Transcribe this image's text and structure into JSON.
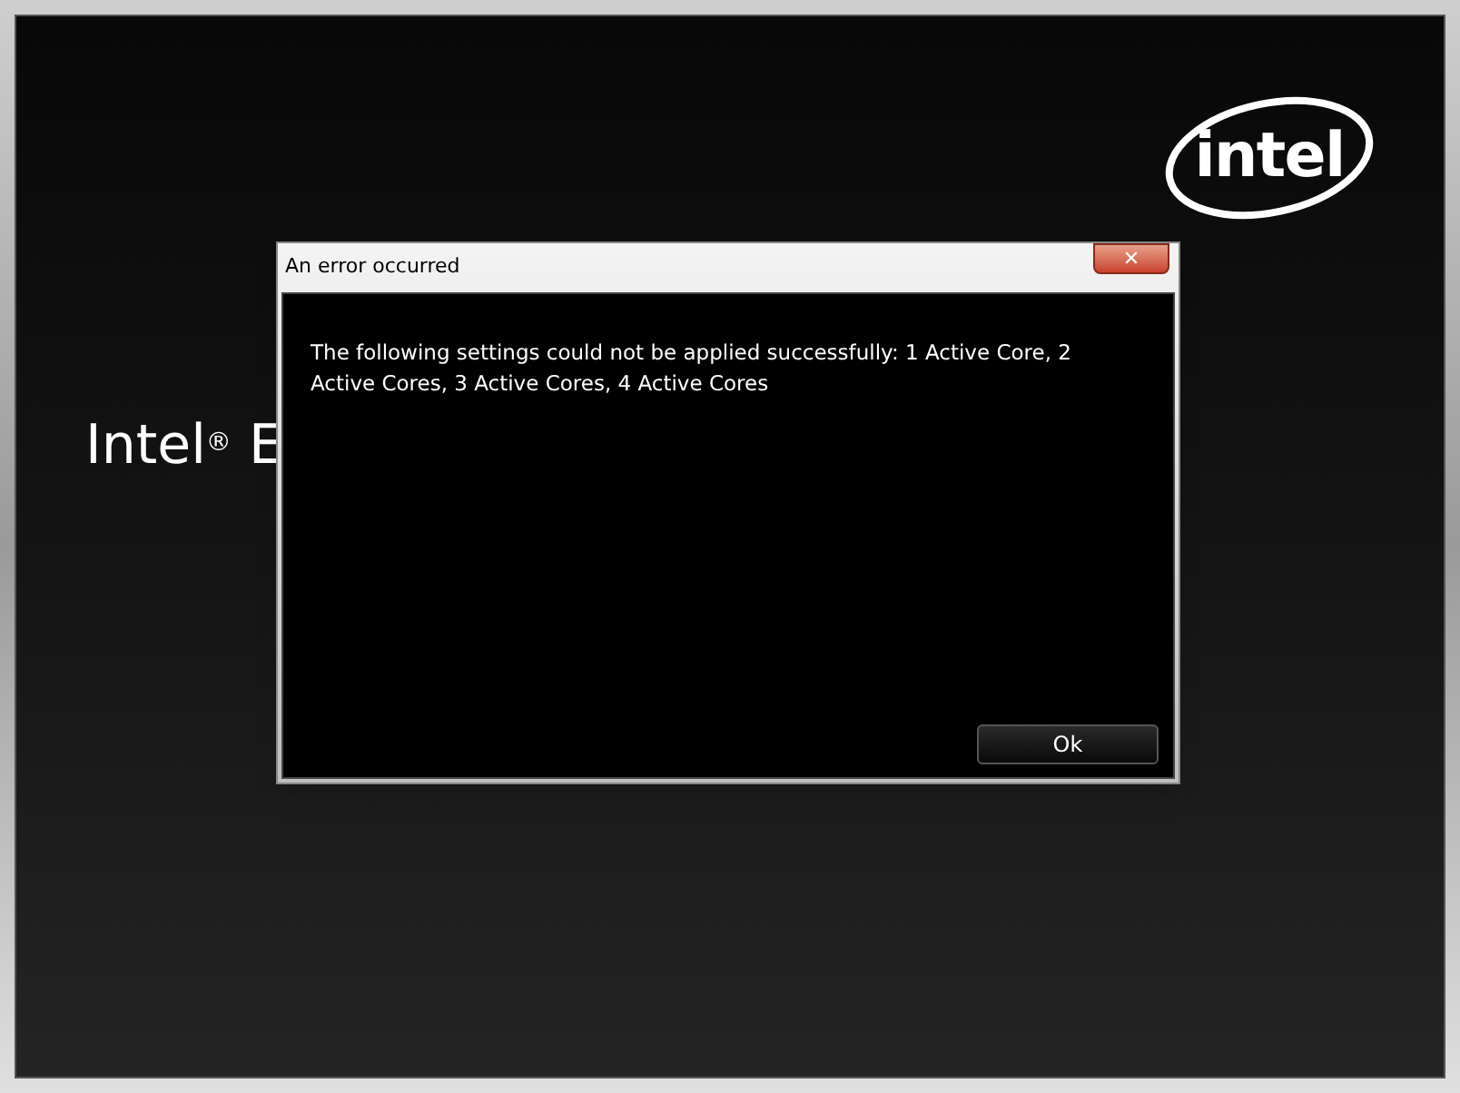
{
  "logo": "intel",
  "heading": "Intel$^{®}$ E",
  "dialog": {
    "title": "An error occurred",
    "close": "✕",
    "message": "The following settings could not be applied successfully: 1 Active Core, 2 Active Cores, 3 Active Cores, 4 Active Cores",
    "buttons": [
      "Ok"
    ]
  }
}
